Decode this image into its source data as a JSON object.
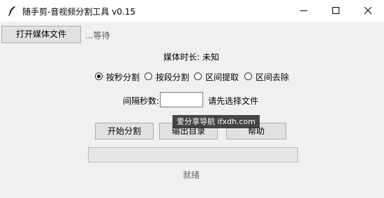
{
  "window": {
    "title": "随手剪-音视频分割工具 v0.15"
  },
  "toolbar": {
    "open_media_label": "打开媒体文件",
    "file_status": "...等待"
  },
  "media": {
    "duration_label": "媒体时长: 未知"
  },
  "modes": {
    "selected": "按秒分割",
    "options": [
      {
        "label": "按秒分割",
        "selected": true
      },
      {
        "label": "按段分割",
        "selected": false
      },
      {
        "label": "区间提取",
        "selected": false
      },
      {
        "label": "区间去除",
        "selected": false
      }
    ]
  },
  "interval": {
    "label": "间隔秒数:",
    "value": "",
    "hint": "请先选择文件"
  },
  "actions": {
    "start_label": "开始分割",
    "output_label": "输出目录",
    "help_label": "帮助"
  },
  "progress": {
    "value": 0
  },
  "status": {
    "text": "就绪"
  },
  "watermark": {
    "text": "爱分享导航 ifxdh.com"
  }
}
